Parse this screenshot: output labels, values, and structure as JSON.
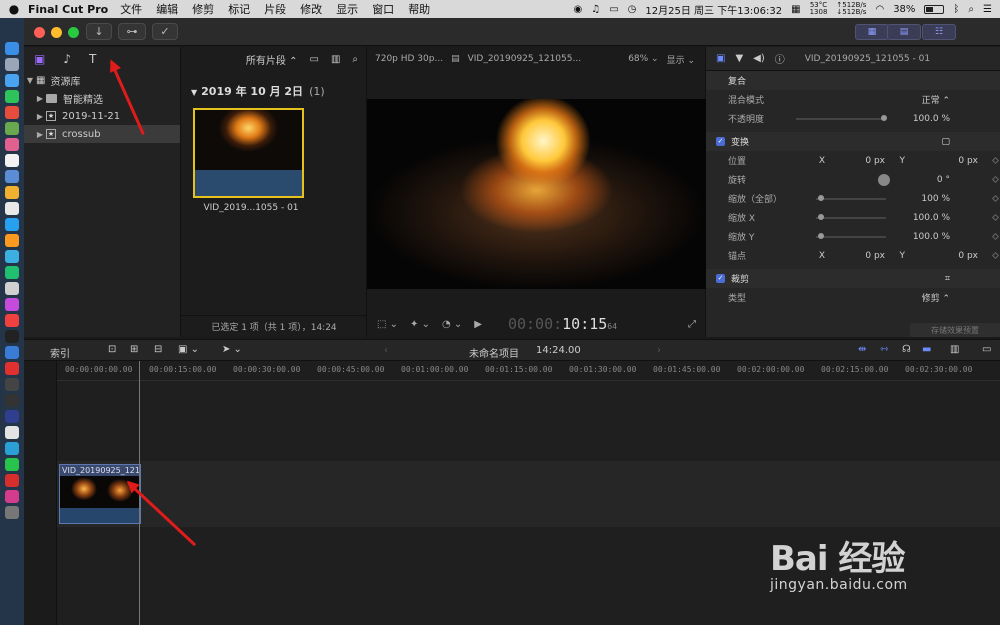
{
  "menubar": {
    "app_name": "Final Cut Pro",
    "items": [
      "文件",
      "编辑",
      "修剪",
      "标记",
      "片段",
      "修改",
      "显示",
      "窗口",
      "帮助"
    ],
    "temp": "53°C",
    "rpm": "1308",
    "net_up": "↑512B/s",
    "net_down": "↓512B/s",
    "battery": "38%",
    "datetime": "12月25日 周三 下午13:06:32"
  },
  "library": {
    "root_label": "资源库",
    "items": [
      {
        "label": "智能精选",
        "icon": "folder-icon"
      },
      {
        "label": "2019-11-21",
        "icon": "event-star-icon"
      },
      {
        "label": "crossub",
        "icon": "event-star-icon",
        "selected": true
      }
    ]
  },
  "browser": {
    "filter_label": "所有片段 ⌃",
    "date_header": "2019 年 10 月 2日",
    "date_count": "(1)",
    "clip_label": "VID_2019...1055 - 01",
    "status": "已选定 1 项（共 1 项），14:24"
  },
  "viewer": {
    "format": "720p HD 30p...",
    "clip_name": "VID_20190925_121055...",
    "zoom": "68% ⌄",
    "view_label": "显示 ⌄",
    "timecode_dim": "00:00:",
    "timecode": "10:15",
    "timecode_frames": "64"
  },
  "inspector": {
    "clip_name": "VID_20190925_121055 - 01",
    "composite_section": "复合",
    "blend_mode_label": "混合模式",
    "blend_mode_value": "正常 ⌃",
    "opacity_label": "不透明度",
    "opacity_value": "100.0 %",
    "opacity_level": 100,
    "transform_section": "变换",
    "position_label": "位置",
    "position_x_label": "X",
    "position_x": "0 px",
    "position_y_label": "Y",
    "position_y": "0 px",
    "rotation_label": "旋转",
    "rotation_value": "0 °",
    "scale_all_label": "缩放（全部）",
    "scale_all_value": "100 %",
    "scale_x_label": "缩放 X",
    "scale_x_value": "100.0 %",
    "scale_y_label": "缩放 Y",
    "scale_y_value": "100.0 %",
    "anchor_label": "锚点",
    "anchor_x_label": "X",
    "anchor_x": "0 px",
    "anchor_y_label": "Y",
    "anchor_y": "0 px",
    "crop_section": "裁剪",
    "type_label": "类型",
    "type_value": "修剪 ⌃",
    "save_preset": "存储效果预置"
  },
  "timeline": {
    "index_label": "索引",
    "project_name": "未命名项目",
    "project_duration": "14:24.00",
    "ruler": [
      "00:00:00:00.00",
      "00:00:15:00.00",
      "00:00:30:00.00",
      "00:00:45:00.00",
      "00:01:00:00.00",
      "00:01:15:00.00",
      "00:01:30:00.00",
      "00:01:45:00.00",
      "00:02:00:00.00",
      "00:02:15:00.00",
      "00:02:30:00.00"
    ],
    "clip_label": "VID_20190925_121..."
  },
  "watermark": {
    "brand": "Bai 经验",
    "url": "jingyan.baidu.com"
  },
  "colors": {
    "accent": "#4a6cd4",
    "selection": "#e6c21c",
    "arrow": "#e01b1b"
  }
}
